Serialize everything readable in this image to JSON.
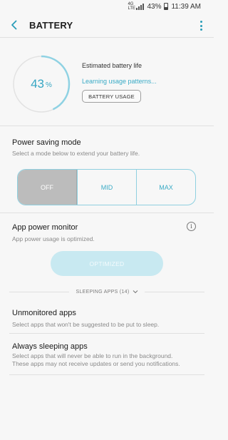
{
  "status_bar": {
    "network": "4G",
    "network_sub": "LTE",
    "battery_pct": "43%",
    "time": "11:39 AM"
  },
  "app_bar": {
    "title": "BATTERY"
  },
  "battery": {
    "level_value": "43",
    "level_unit": "%",
    "level_fraction": 0.43,
    "estimated_label": "Estimated battery life",
    "learning_text": "Learning usage patterns...",
    "usage_button": "BATTERY USAGE"
  },
  "power_saving": {
    "title": "Power saving mode",
    "subtitle": "Select a mode below to extend your battery life.",
    "options": [
      "OFF",
      "MID",
      "MAX"
    ],
    "selected": "OFF"
  },
  "app_power_monitor": {
    "title": "App power monitor",
    "subtitle": "App power usage is optimized.",
    "button": "OPTIMIZED",
    "info_glyph": "i"
  },
  "sleeping_apps": {
    "label": "SLEEPING APPS (14)"
  },
  "unmonitored": {
    "title": "Unmonitored apps",
    "subtitle": "Select apps that won't be suggested to be put to sleep."
  },
  "always_sleeping": {
    "title": "Always sleeping apps",
    "subtitle_line1": "Select apps that will never be able to run in the background.",
    "subtitle_line2": "These apps may not receive updates or send you notifications."
  },
  "colors": {
    "accent": "#3aabc6",
    "disabled_button": "#c8e9f1",
    "selected_segment": "#bcbcbc"
  }
}
